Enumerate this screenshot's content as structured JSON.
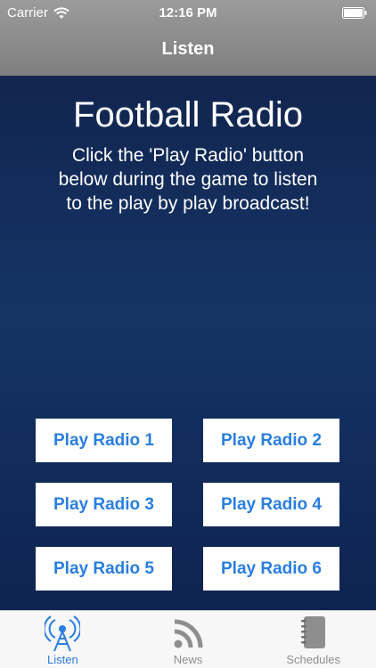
{
  "status_bar": {
    "carrier": "Carrier",
    "time": "12:16 PM"
  },
  "nav": {
    "title": "Listen"
  },
  "main": {
    "heading": "Football Radio",
    "description": "Click the 'Play Radio' button below during the game to listen to the play by play broadcast!",
    "buttons": [
      {
        "label": "Play Radio 1"
      },
      {
        "label": "Play Radio 2"
      },
      {
        "label": "Play Radio 3"
      },
      {
        "label": "Play Radio 4"
      },
      {
        "label": "Play Radio 5"
      },
      {
        "label": "Play Radio 6"
      }
    ]
  },
  "tabs": [
    {
      "label": "Listen",
      "icon": "radio-tower-icon",
      "active": true
    },
    {
      "label": "News",
      "icon": "rss-icon",
      "active": false
    },
    {
      "label": "Schedules",
      "icon": "notebook-icon",
      "active": false
    }
  ],
  "colors": {
    "accent": "#2a7ee0",
    "background": "#12254f",
    "nav_bar": "#8a8a8a",
    "tab_bar": "#f7f7f7",
    "inactive_tab": "#8e8e8e"
  }
}
